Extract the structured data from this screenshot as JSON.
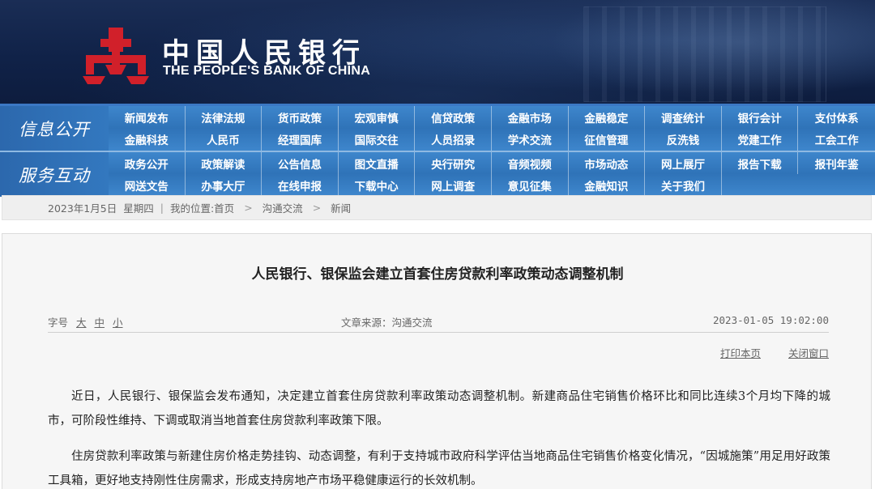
{
  "header": {
    "logo_cn": "中国人民银行",
    "logo_en": "THE PEOPLE'S BANK OF CHINA",
    "logo_icon": "pboc-emblem-icon",
    "brand_color": "#d1202a"
  },
  "nav": {
    "info": {
      "category": "信息公开",
      "items": [
        "新闻发布",
        "法律法规",
        "货币政策",
        "宏观审慎",
        "信贷政策",
        "金融市场",
        "金融稳定",
        "调查统计",
        "银行会计",
        "支付体系",
        "金融科技",
        "人民币",
        "经理国库",
        "国际交往",
        "人员招录",
        "学术交流",
        "征信管理",
        "反洗钱",
        "党建工作",
        "工会工作"
      ]
    },
    "service": {
      "category": "服务互动",
      "items": [
        "政务公开",
        "政策解读",
        "公告信息",
        "图文直播",
        "央行研究",
        "音频视频",
        "市场动态",
        "网上展厅",
        "报告下载",
        "报刊年鉴",
        "网送文告",
        "办事大厅",
        "在线申报",
        "下载中心",
        "网上调查",
        "意见征集",
        "金融知识",
        "关于我们",
        "",
        ""
      ]
    },
    "accent_color": "#3378bf"
  },
  "breadcrumb": {
    "date": "2023年1月5日",
    "weekday": "星期四",
    "location_label": "我的位置:",
    "home": "首页",
    "level1": "沟通交流",
    "level2": "新闻",
    "arrow": ">"
  },
  "article": {
    "title": "人民银行、银保监会建立首套住房贷款利率政策动态调整机制",
    "font_label": "字号",
    "font_large": "大",
    "font_medium": "中",
    "font_small": "小",
    "source": "文章来源：沟通交流",
    "time": "2023-01-05 19:02:00",
    "print": "打印本页",
    "close": "关闭窗口",
    "paragraphs": [
      "近日，人民银行、银保监会发布通知，决定建立首套住房贷款利率政策动态调整机制。新建商品住宅销售价格环比和同比连续3个月均下降的城市，可阶段性维持、下调或取消当地首套住房贷款利率政策下限。",
      "住房贷款利率政策与新建住房价格走势挂钩、动态调整，有利于支持城市政府科学评估当地商品住宅销售价格变化情况，“因城施策”用足用好政策工具箱，更好地支持刚性住房需求，形成支持房地产市场平稳健康运行的长效机制。"
    ]
  }
}
